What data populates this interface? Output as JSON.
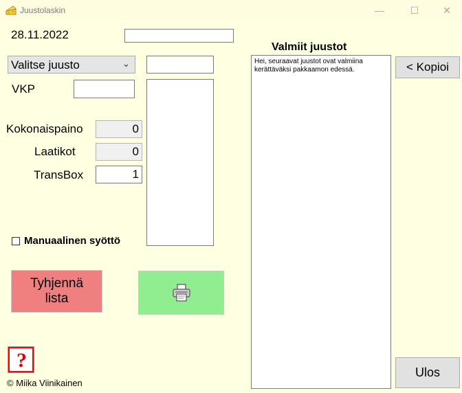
{
  "window": {
    "title": "Juustolaskin",
    "minimize_glyph": "—",
    "maximize_glyph": "☐",
    "close_glyph": "✕"
  },
  "form": {
    "date": "28.11.2022",
    "top_input_value": "",
    "cheese_select": {
      "selected": "Valitse juusto",
      "arrow_glyph": "⌄"
    },
    "code_input_value": "",
    "vkp_label": "VKP",
    "vkp_value": "",
    "kokonaispaino_label": "Kokonaispaino",
    "kokonaispaino_value": "0",
    "laatikot_label": "Laatikot",
    "laatikot_value": "0",
    "transbox_label": "TransBox",
    "transbox_value": "1",
    "manual_label": "Manuaalinen syöttö",
    "clear_button_label": "Tyhjennä lista",
    "help_glyph": "?",
    "copyright": "© Miika Viinikainen"
  },
  "ready": {
    "title": "Valmiit juustot",
    "text": "Hei, seuraavat juustot ovat valmiina kerättäväksi pakkaamon edessä.",
    "copy_button_label": "< Kopioi",
    "exit_button_label": "Ulos"
  },
  "colors": {
    "background": "#ffffe1",
    "clear_button": "#f08080",
    "print_button": "#90ee90",
    "help_icon": "#ff0000"
  },
  "icons": {
    "app": "cheese-icon",
    "print": "printer-icon",
    "help": "help-icon"
  }
}
